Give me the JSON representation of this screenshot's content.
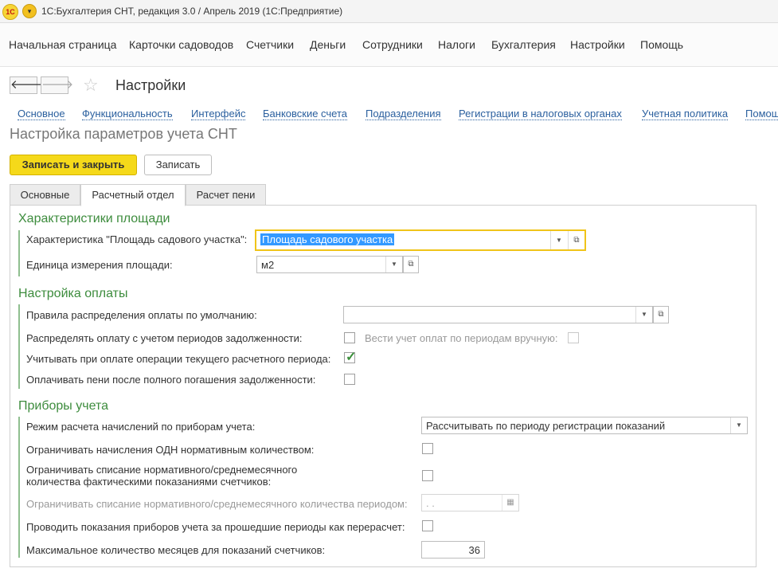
{
  "window": {
    "title": "1С:Бухгалтерия СНТ, редакция 3.0 / Апрель 2019   (1С:Предприятие)"
  },
  "menu": [
    "Начальная страница",
    "Карточки садоводов",
    "Счетчики",
    "Деньги",
    "Сотрудники",
    "Налоги",
    "Бухгалтерия",
    "Настройки",
    "Помощь"
  ],
  "form": {
    "title": "Настройки",
    "links": [
      "Основное",
      "Функциональность",
      "Интерфейс",
      "Банковские счета",
      "Подразделения",
      "Регистрации в налоговых органах",
      "Учетная политика",
      "Помощ"
    ],
    "subtitle": "Настройка параметров учета СНТ",
    "save_close": "Записать и закрыть",
    "save": "Записать",
    "tabs": [
      "Основные",
      "Расчетный отдел",
      "Расчет пени"
    ]
  },
  "area": {
    "header": "Характеристики площади",
    "char_label": "Характеристика \"Площадь садового участка\":",
    "char_value": "Площадь садового участка",
    "unit_label": "Единица измерения площади:",
    "unit_value": "м2"
  },
  "payment": {
    "header": "Настройка оплаты",
    "rules_label": "Правила распределения оплаты по умолчанию:",
    "rules_value": "",
    "periods_label": "Распределять оплату с учетом периодов задолженности:",
    "periods_checked": false,
    "manual_label": "Вести учет оплат по периодам вручную:",
    "manual_checked": false,
    "current_label": "Учитывать при оплате операции текущего расчетного периода:",
    "current_checked": true,
    "penalty_label": "Оплачивать пени после полного погашения задолженности:",
    "penalty_checked": false
  },
  "meters": {
    "header": "Приборы учета",
    "mode_label": "Режим расчета начислений по приборам учета:",
    "mode_value": "Рассчитывать по периоду регистрации показаний",
    "odn_label": "Ограничивать начисления ОДН нормативным количеством:",
    "odn_checked": false,
    "writeoff_label_1": "Ограничивать списание нормативного/среднемесячного",
    "writeoff_label_2": "количества фактическими показаниями счетчиков:",
    "writeoff_checked": false,
    "period_label": "Ограничивать списание нормативного/среднемесячного количества периодом:",
    "period_value": " .  .",
    "recalc_label": "Проводить показания приборов учета за прошедшие периоды как перерасчет:",
    "recalc_checked": false,
    "months_label": "Максимальное количество месяцев для показаний счетчиков:",
    "months_value": "36"
  },
  "colors": {
    "accent_yellow": "#f5d91a",
    "section_green": "#3d8c3d",
    "link_blue": "#2a5f9e",
    "focus": "#f0c419",
    "selection": "#3399ff"
  }
}
